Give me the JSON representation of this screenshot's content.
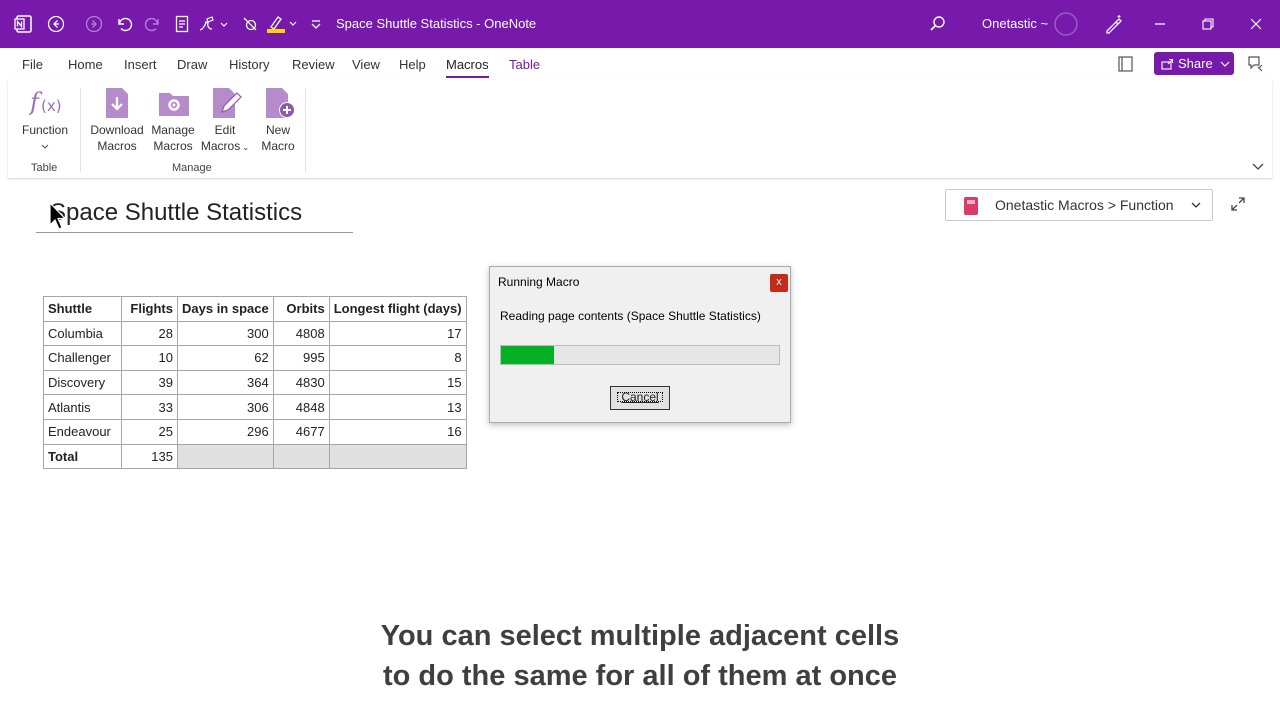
{
  "titlebar": {
    "doc_title": "Space Shuttle Statistics  -  OneNote",
    "account": "Onetastic ~",
    "bg_color": "#7719aa"
  },
  "menu": {
    "tabs": [
      "File",
      "Home",
      "Insert",
      "Draw",
      "History",
      "Review",
      "View",
      "Help",
      "Macros",
      "Table"
    ],
    "active": "Macros",
    "share_label": "Share"
  },
  "ribbon": {
    "function_label": "Function",
    "table_group": "Table",
    "manage_group": "Manage",
    "download_line1": "Download",
    "download_line2": "Macros",
    "manage_line1": "Manage",
    "manage_line2": "Macros",
    "edit_line1": "Edit",
    "edit_line2": "Macros",
    "new_line1": "New",
    "new_line2": "Macro"
  },
  "page": {
    "title": "Space Shuttle Statistics",
    "breadcrumb": "Onetastic Macros > Function"
  },
  "table": {
    "headers": [
      "Shuttle",
      "Flights",
      "Days in space",
      "Orbits",
      "Longest flight (days)"
    ],
    "rows": [
      [
        "Columbia",
        "28",
        "300",
        "4808",
        "17"
      ],
      [
        "Challenger",
        "10",
        "62",
        "995",
        "8"
      ],
      [
        "Discovery",
        "39",
        "364",
        "4830",
        "15"
      ],
      [
        "Atlantis",
        "33",
        "306",
        "4848",
        "13"
      ],
      [
        "Endeavour",
        "25",
        "296",
        "4677",
        "16"
      ]
    ],
    "total_label": "Total",
    "total_flights": "135"
  },
  "dialog": {
    "title": "Running Macro",
    "close": "x",
    "message": "Reading page contents (Space Shuttle Statistics)",
    "progress": 0.19,
    "cancel": "Cancel"
  },
  "caption": {
    "line1": "You can select multiple adjacent cells",
    "line2": "to do the same for all of them at once"
  }
}
